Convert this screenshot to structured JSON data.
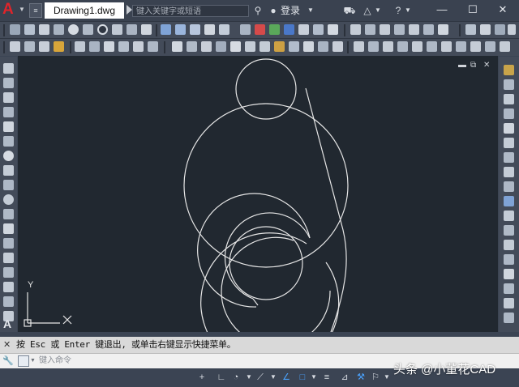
{
  "window": {
    "doc_tab": "Drawing1.dwg",
    "search_placeholder": "键入关键字或短语",
    "login_label": "登录"
  },
  "command": {
    "history_text": "按 Esc 或 Enter 键退出, 或单击右键显示快捷菜单。",
    "input_placeholder": "键入命令"
  },
  "ucs": {
    "x_label": "X",
    "y_label": "Y"
  },
  "watermark": "头条 @小董花CAD",
  "colors": {
    "title_bg": "#3a4250",
    "toolbar_bg": "#434b59",
    "canvas_bg": "#212830",
    "drawing_stroke": "#e6e6e6",
    "logo_red": "#e0242a"
  },
  "icons": {
    "logo": "autocad-logo",
    "binoculars": "binoculars-icon",
    "user": "user-icon",
    "cart": "cart-icon",
    "triangle": "exchange-icon",
    "help": "help-icon"
  }
}
